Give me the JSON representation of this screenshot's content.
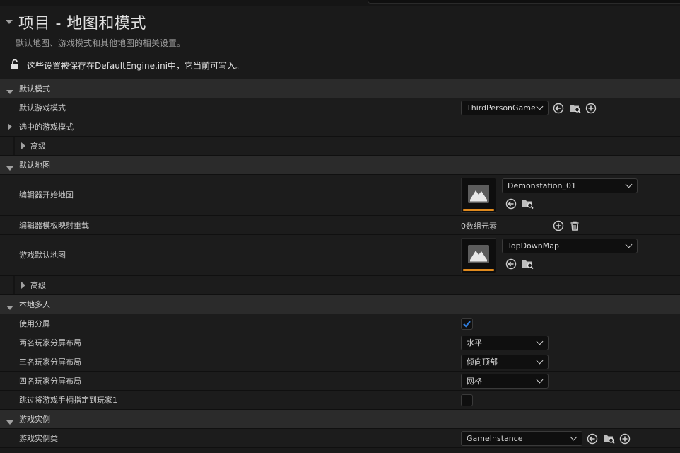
{
  "header": {
    "title": "项目 - 地图和模式",
    "subtitle": "默认地图、游戏模式和其他地图的相关设置。",
    "config_notice": "这些设置被保存在DefaultEngine.ini中，它当前可写入。"
  },
  "sections": {
    "default_modes": {
      "label": "默认模式",
      "default_gamemode": {
        "label": "默认游戏模式",
        "value": "ThirdPersonGame"
      },
      "selected_gamemode": {
        "label": "选中的游戏模式"
      },
      "advanced": {
        "label": "高级"
      }
    },
    "default_maps": {
      "label": "默认地图",
      "editor_startup_map": {
        "label": "编辑器开始地图",
        "value": "Demonstation_01"
      },
      "editor_template_override": {
        "label": "编辑器模板映射重载",
        "value": "0数组元素"
      },
      "game_default_map": {
        "label": "游戏默认地图",
        "value": "TopDownMap"
      },
      "advanced": {
        "label": "高级"
      }
    },
    "local_multiplayer": {
      "label": "本地多人",
      "use_splitscreen": {
        "label": "使用分屏",
        "checked": true
      },
      "two_player_layout": {
        "label": "两名玩家分屏布局",
        "value": "水平"
      },
      "three_player_layout": {
        "label": "三名玩家分屏布局",
        "value": "倾向顶部"
      },
      "four_player_layout": {
        "label": "四名玩家分屏布局",
        "value": "网格"
      },
      "skip_assign_gamepad": {
        "label": "跳过将游戏手柄指定到玩家1",
        "checked": false
      }
    },
    "game_instance": {
      "label": "游戏实例",
      "game_instance_class": {
        "label": "游戏实例类",
        "value": "GameInstance"
      }
    }
  },
  "colors": {
    "accent_orange": "#e08a1e",
    "check_blue": "#2f7bd8",
    "background": "#1a1a1a",
    "category_row": "#2b2b2b"
  },
  "icons": [
    "chevron-down-icon",
    "unlocked-icon",
    "browse-back-arrow-icon",
    "folder-search-icon",
    "add-circle-icon",
    "trash-icon",
    "checkmark-icon",
    "map-thumbnail-icon"
  ]
}
